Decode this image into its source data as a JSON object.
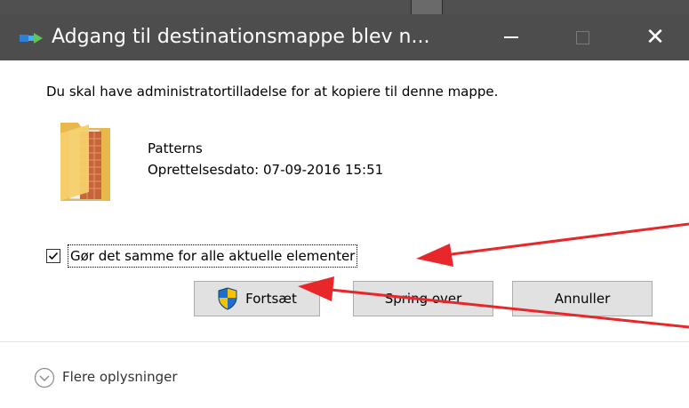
{
  "dialog": {
    "title": "Adgang til destinationsmappe blev n...",
    "message": "Du skal have administratortilladelse for at kopiere til denne mappe.",
    "file": {
      "name": "Patterns",
      "date": "Oprettelsesdato: 07-09-2016 15:51",
      "icon": "folder-icon"
    },
    "checkbox": {
      "label": "Gør det samme for alle aktuelle elementer",
      "checked": true
    },
    "buttons": {
      "continue": "Fortsæt",
      "skip": "Spring over",
      "cancel": "Annuller"
    },
    "more_info": "Flere oplysninger"
  },
  "colors": {
    "titlebar": "#4d4d4d",
    "button_bg": "#e1e1e1",
    "annotation_arrow": "#e8272b",
    "shield_blue": "#1f6fc9",
    "shield_yellow": "#f5c200"
  }
}
